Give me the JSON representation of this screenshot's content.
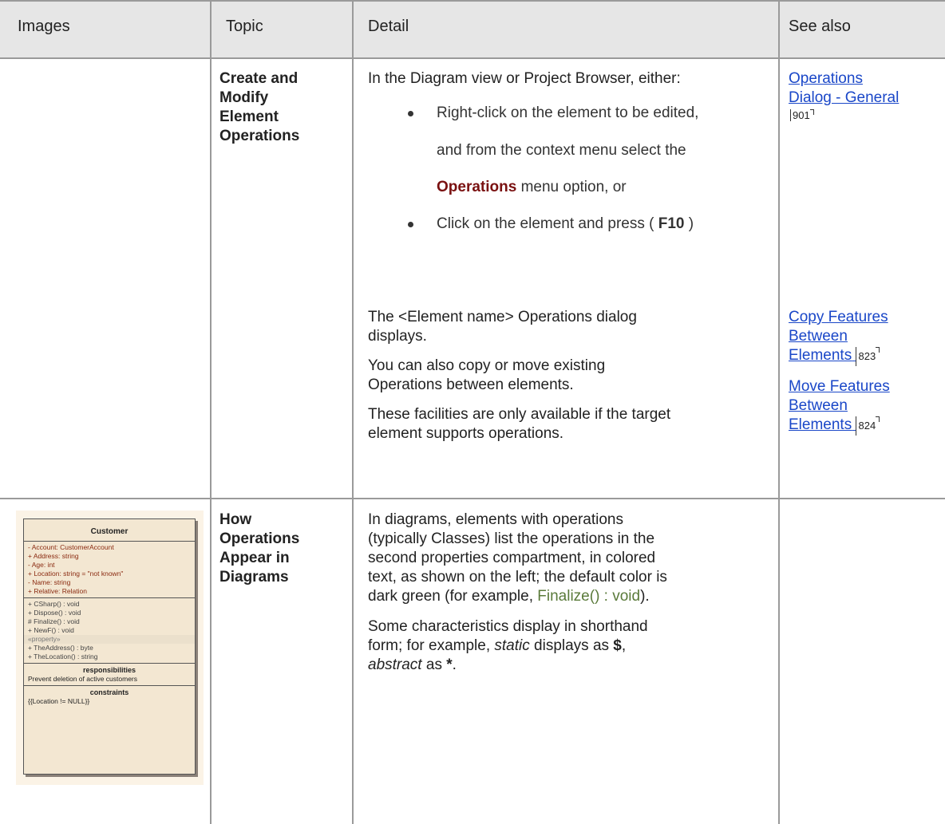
{
  "header": {
    "images": "Images",
    "topic": "Topic",
    "detail": "Detail",
    "see_also": "See also"
  },
  "row1": {
    "topic_lines": [
      "Create and",
      "Modify",
      "Element",
      "Operations"
    ],
    "intro": "In the Diagram view or Project Browser, either:",
    "bullet1_line1": "Right-click on the element to be edited,",
    "bullet1_line2": "and from the context menu select the",
    "bullet1_em": "Operations",
    "bullet1_line3_rest": " menu option, or",
    "bullet2_pre": "Click on the element and press ( ",
    "bullet2_key": "F10",
    "bullet2_post": " )",
    "links": [
      {
        "lines": [
          "Operations",
          "Dialog - General"
        ],
        "page": "901"
      }
    ]
  },
  "row2": {
    "para1_line1": "The <Element name> Operations dialog",
    "para1_line2": "displays.",
    "para2_line1": "You can also copy or move existing",
    "para2_line2": "Operations between elements.",
    "para3_line1": "These facilities are only available if the target",
    "para3_line2": "element supports operations.",
    "links": [
      {
        "lines": [
          "Copy Features",
          "Between",
          "Elements"
        ],
        "page": "823"
      },
      {
        "lines": [
          "Move Features",
          "Between",
          "Elements"
        ],
        "page": "824"
      }
    ]
  },
  "row3": {
    "topic_lines": [
      "How",
      "Operations",
      "Appear in",
      "Diagrams"
    ],
    "para1_line1": "In diagrams, elements with operations",
    "para1_line2": "(typically Classes) list the operations in the",
    "para1_line3": "second properties compartment, in colored",
    "para1_line4": "text, as shown on the left; the default color is",
    "para1_line5_pre": "dark green (for example, ",
    "para1_line5_green": "Finalize() : void",
    "para1_line5_post": ").",
    "para2_line1": "Some characteristics display in shorthand",
    "para2_line2_pre": "form; for example, ",
    "para2_line2_static": "static",
    "para2_line2_mid": " displays as ",
    "para2_line2_dollar": "$",
    "para2_line2_comma": ",",
    "para2_line3_abstract": "abstract",
    "para2_line3_mid": " as ",
    "para2_line3_star": "*",
    "para2_line3_end": "."
  },
  "uml": {
    "class_name": "Customer",
    "attributes": [
      "-   Account:  CustomerAccount",
      "+   Address:  string",
      "-   Age:  int",
      "+   Location:  string = \"not known\"",
      "-   Name:  string",
      "+   Relative:  Relation"
    ],
    "operations": [
      "+   CSharp() : void",
      "+   Dispose() : void",
      "#   Finalize() : void",
      "+   NewF() : void"
    ],
    "stereotype": "«property»",
    "property_ops": [
      "+   TheAddress() : byte",
      "+   TheLocation() : string"
    ],
    "responsibilities_title": "responsibilities",
    "responsibilities_text": "Prevent deletion of active customers",
    "constraints_title": "constraints",
    "constraints_text": "{{Location != NULL}}"
  }
}
